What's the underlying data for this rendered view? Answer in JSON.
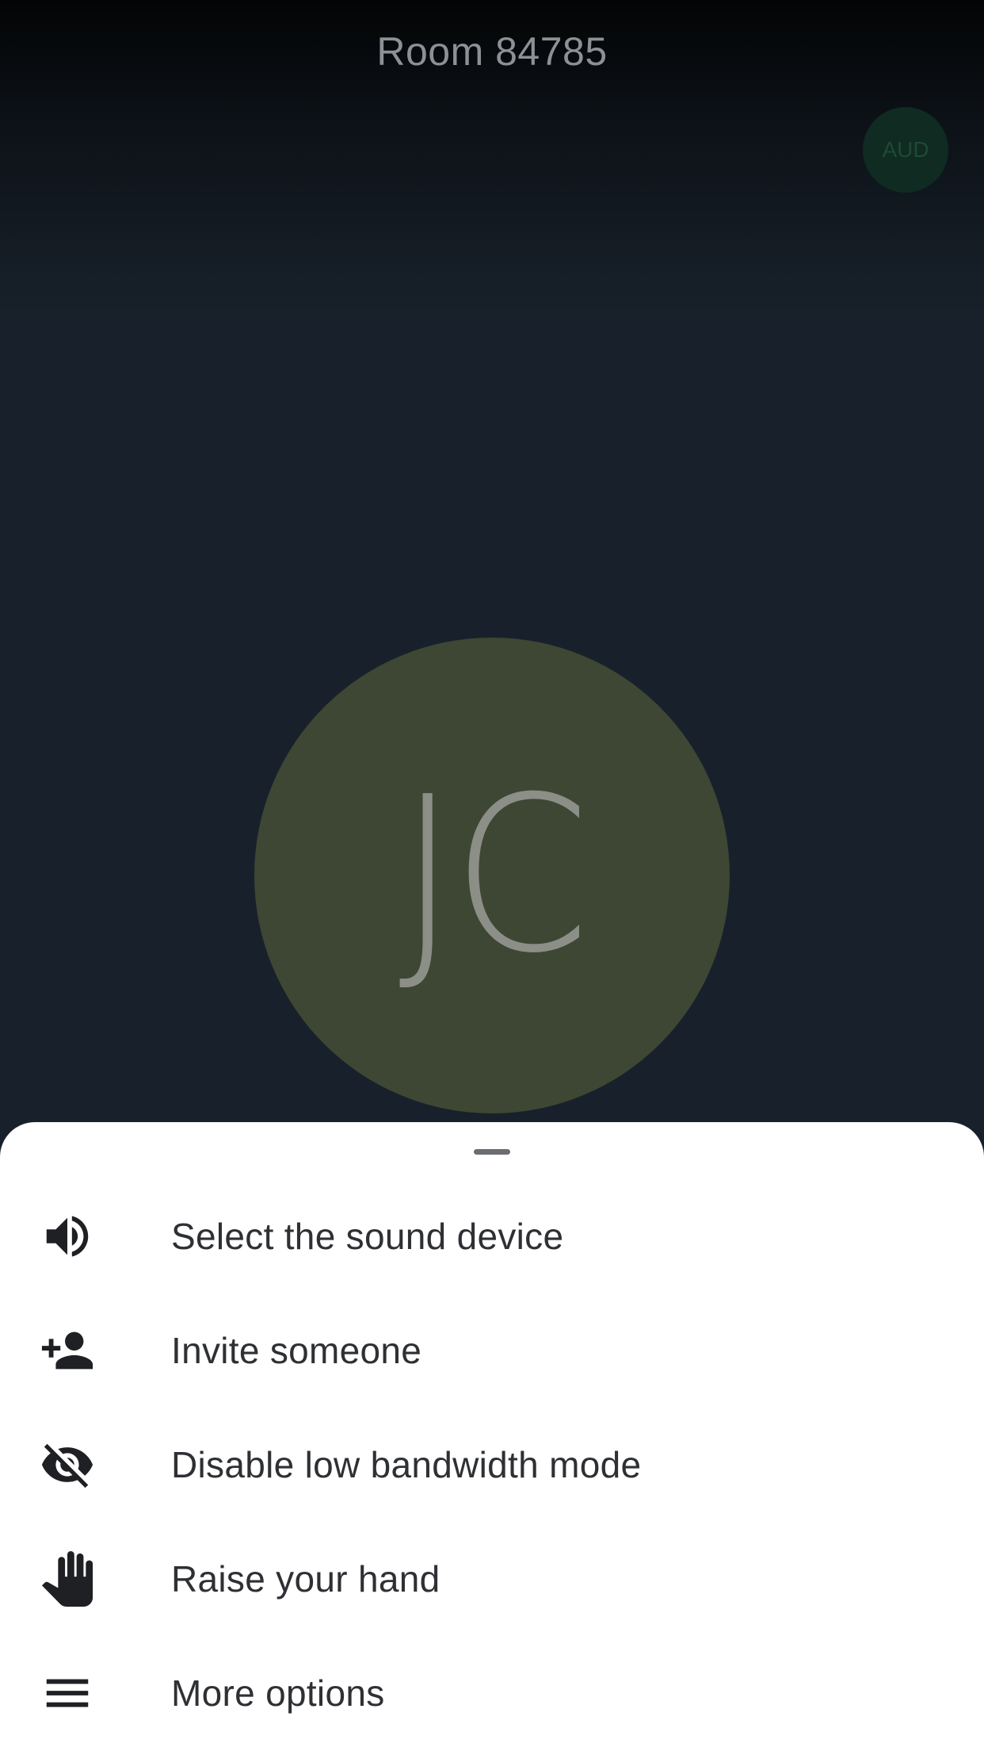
{
  "call": {
    "room_title": "Room 84785",
    "audio_badge": "AUD",
    "participant_initials": "JC"
  },
  "colors": {
    "avatar_bg": "#3e4733",
    "audio_badge_bg": "#0f2b22",
    "sheet_bg": "#ffffff"
  },
  "menu": {
    "items": [
      {
        "label": "Select the sound device",
        "icon": "volume-up-icon"
      },
      {
        "label": "Invite someone",
        "icon": "person-add-icon"
      },
      {
        "label": "Disable low bandwidth mode",
        "icon": "visibility-off-icon"
      },
      {
        "label": "Raise your hand",
        "icon": "hand-icon"
      },
      {
        "label": "More options",
        "icon": "menu-icon"
      }
    ]
  }
}
